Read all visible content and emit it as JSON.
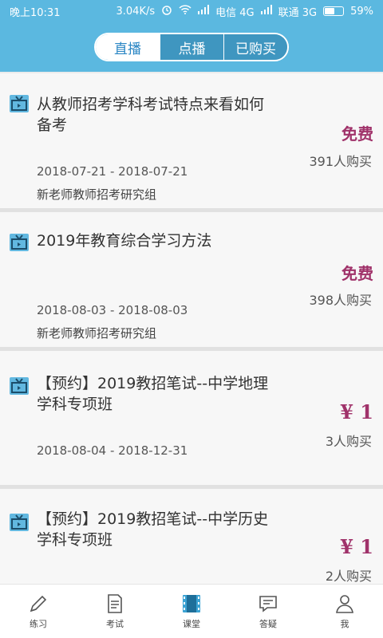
{
  "status_bar": {
    "time": "晚上10:31",
    "speed": "3.04K/s",
    "carrier1": "电信 4G",
    "carrier2": "联通 3G",
    "battery": "59%",
    "battery_level": 0.59
  },
  "header": {
    "tabs": [
      {
        "label": "直播",
        "active": true
      },
      {
        "label": "点播",
        "active": false
      },
      {
        "label": "已购买",
        "active": false
      }
    ]
  },
  "courses": [
    {
      "title": "从教师招考学科考试特点来看如何备考",
      "price": "免费",
      "buyers": "391人购买",
      "date": "2018-07-21 - 2018-07-21",
      "group": "新老师教师招考研究组"
    },
    {
      "title": "2019年教育综合学习方法",
      "price": "免费",
      "buyers": "398人购买",
      "date": "2018-08-03 - 2018-08-03",
      "group": "新老师教师招考研究组"
    },
    {
      "title": "【预约】2019教招笔试--中学地理学科专项班",
      "price": "¥ 1",
      "buyers": "3人购买",
      "date": "2018-08-04 - 2018-12-31",
      "group": ""
    },
    {
      "title": "【预约】2019教招笔试--中学历史学科专项班",
      "price": "¥ 1",
      "buyers": "2人购买",
      "date": "",
      "group": ""
    }
  ],
  "bottom_nav": [
    {
      "label": "练习",
      "icon": "pencil-icon"
    },
    {
      "label": "考试",
      "icon": "exam-paper-icon"
    },
    {
      "label": "课堂",
      "icon": "video-film-icon",
      "active": true
    },
    {
      "label": "答疑",
      "icon": "chat-icon"
    },
    {
      "label": "我",
      "icon": "user-icon"
    }
  ],
  "colors": {
    "primary": "#5bb8e0",
    "accent": "#2a86c4",
    "price": "#a0326a"
  }
}
